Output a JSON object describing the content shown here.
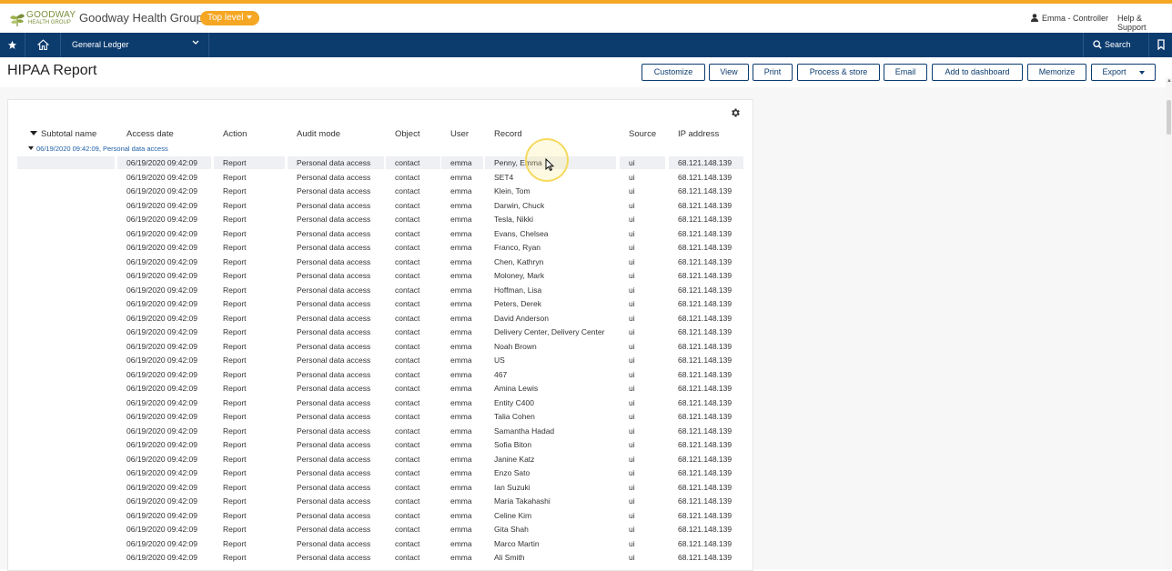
{
  "brand": {
    "logo_line1": "GOODWAY",
    "logo_line2": "HEALTH GROUP",
    "company": "Goodway Health Group",
    "level_badge": "Top level",
    "accent_color": "#f5a623",
    "nav_color": "#0c3b6e"
  },
  "header": {
    "user": "Emma - Controller",
    "help": "Help & Support"
  },
  "nav": {
    "app": "General Ledger",
    "search": "Search"
  },
  "page": {
    "title": "HIPAA Report",
    "buttons": {
      "customize": "Customize",
      "view": "View",
      "print": "Print",
      "process": "Process & store",
      "email": "Email",
      "dashboard": "Add to dashboard",
      "memorize": "Memorize",
      "export": "Export"
    }
  },
  "table": {
    "columns": {
      "subtotal": "Subtotal name",
      "access_date": "Access date",
      "action": "Action",
      "audit_mode": "Audit mode",
      "object": "Object",
      "user": "User",
      "record": "Record",
      "source": "Source",
      "ip": "IP address"
    },
    "group_label": "06/19/2020 09:42:09, Personal data access",
    "rows": [
      {
        "date": "06/19/2020 09:42:09",
        "action": "Report",
        "mode": "Personal data access",
        "object": "contact",
        "user": "emma",
        "record": "Penny, Emma",
        "source": "ui",
        "ip": "68.121.148.139"
      },
      {
        "date": "06/19/2020 09:42:09",
        "action": "Report",
        "mode": "Personal data access",
        "object": "contact",
        "user": "emma",
        "record": "SET4",
        "source": "ui",
        "ip": "68.121.148.139"
      },
      {
        "date": "06/19/2020 09:42:09",
        "action": "Report",
        "mode": "Personal data access",
        "object": "contact",
        "user": "emma",
        "record": "Klein, Tom",
        "source": "ui",
        "ip": "68.121.148.139"
      },
      {
        "date": "06/19/2020 09:42:09",
        "action": "Report",
        "mode": "Personal data access",
        "object": "contact",
        "user": "emma",
        "record": "Darwin, Chuck",
        "source": "ui",
        "ip": "68.121.148.139"
      },
      {
        "date": "06/19/2020 09:42:09",
        "action": "Report",
        "mode": "Personal data access",
        "object": "contact",
        "user": "emma",
        "record": "Tesla, Nikki",
        "source": "ui",
        "ip": "68.121.148.139"
      },
      {
        "date": "06/19/2020 09:42:09",
        "action": "Report",
        "mode": "Personal data access",
        "object": "contact",
        "user": "emma",
        "record": "Evans, Chelsea",
        "source": "ui",
        "ip": "68.121.148.139"
      },
      {
        "date": "06/19/2020 09:42:09",
        "action": "Report",
        "mode": "Personal data access",
        "object": "contact",
        "user": "emma",
        "record": "Franco, Ryan",
        "source": "ui",
        "ip": "68.121.148.139"
      },
      {
        "date": "06/19/2020 09:42:09",
        "action": "Report",
        "mode": "Personal data access",
        "object": "contact",
        "user": "emma",
        "record": "Chen, Kathryn",
        "source": "ui",
        "ip": "68.121.148.139"
      },
      {
        "date": "06/19/2020 09:42:09",
        "action": "Report",
        "mode": "Personal data access",
        "object": "contact",
        "user": "emma",
        "record": "Moloney, Mark",
        "source": "ui",
        "ip": "68.121.148.139"
      },
      {
        "date": "06/19/2020 09:42:09",
        "action": "Report",
        "mode": "Personal data access",
        "object": "contact",
        "user": "emma",
        "record": "Hoffman, Lisa",
        "source": "ui",
        "ip": "68.121.148.139"
      },
      {
        "date": "06/19/2020 09:42:09",
        "action": "Report",
        "mode": "Personal data access",
        "object": "contact",
        "user": "emma",
        "record": "Peters, Derek",
        "source": "ui",
        "ip": "68.121.148.139"
      },
      {
        "date": "06/19/2020 09:42:09",
        "action": "Report",
        "mode": "Personal data access",
        "object": "contact",
        "user": "emma",
        "record": "David Anderson",
        "source": "ui",
        "ip": "68.121.148.139"
      },
      {
        "date": "06/19/2020 09:42:09",
        "action": "Report",
        "mode": "Personal data access",
        "object": "contact",
        "user": "emma",
        "record": "Delivery Center, Delivery Center",
        "source": "ui",
        "ip": "68.121.148.139"
      },
      {
        "date": "06/19/2020 09:42:09",
        "action": "Report",
        "mode": "Personal data access",
        "object": "contact",
        "user": "emma",
        "record": "Noah Brown",
        "source": "ui",
        "ip": "68.121.148.139"
      },
      {
        "date": "06/19/2020 09:42:09",
        "action": "Report",
        "mode": "Personal data access",
        "object": "contact",
        "user": "emma",
        "record": "US",
        "source": "ui",
        "ip": "68.121.148.139"
      },
      {
        "date": "06/19/2020 09:42:09",
        "action": "Report",
        "mode": "Personal data access",
        "object": "contact",
        "user": "emma",
        "record": "467",
        "source": "ui",
        "ip": "68.121.148.139"
      },
      {
        "date": "06/19/2020 09:42:09",
        "action": "Report",
        "mode": "Personal data access",
        "object": "contact",
        "user": "emma",
        "record": "Amina Lewis",
        "source": "ui",
        "ip": "68.121.148.139"
      },
      {
        "date": "06/19/2020 09:42:09",
        "action": "Report",
        "mode": "Personal data access",
        "object": "contact",
        "user": "emma",
        "record": "Entity C400",
        "source": "ui",
        "ip": "68.121.148.139"
      },
      {
        "date": "06/19/2020 09:42:09",
        "action": "Report",
        "mode": "Personal data access",
        "object": "contact",
        "user": "emma",
        "record": "Talia Cohen",
        "source": "ui",
        "ip": "68.121.148.139"
      },
      {
        "date": "06/19/2020 09:42:09",
        "action": "Report",
        "mode": "Personal data access",
        "object": "contact",
        "user": "emma",
        "record": "Samantha Hadad",
        "source": "ui",
        "ip": "68.121.148.139"
      },
      {
        "date": "06/19/2020 09:42:09",
        "action": "Report",
        "mode": "Personal data access",
        "object": "contact",
        "user": "emma",
        "record": "Sofia Biton",
        "source": "ui",
        "ip": "68.121.148.139"
      },
      {
        "date": "06/19/2020 09:42:09",
        "action": "Report",
        "mode": "Personal data access",
        "object": "contact",
        "user": "emma",
        "record": "Janine Katz",
        "source": "ui",
        "ip": "68.121.148.139"
      },
      {
        "date": "06/19/2020 09:42:09",
        "action": "Report",
        "mode": "Personal data access",
        "object": "contact",
        "user": "emma",
        "record": "Enzo Sato",
        "source": "ui",
        "ip": "68.121.148.139"
      },
      {
        "date": "06/19/2020 09:42:09",
        "action": "Report",
        "mode": "Personal data access",
        "object": "contact",
        "user": "emma",
        "record": "Ian Suzuki",
        "source": "ui",
        "ip": "68.121.148.139"
      },
      {
        "date": "06/19/2020 09:42:09",
        "action": "Report",
        "mode": "Personal data access",
        "object": "contact",
        "user": "emma",
        "record": "Maria Takahashi",
        "source": "ui",
        "ip": "68.121.148.139"
      },
      {
        "date": "06/19/2020 09:42:09",
        "action": "Report",
        "mode": "Personal data access",
        "object": "contact",
        "user": "emma",
        "record": "Celine Kim",
        "source": "ui",
        "ip": "68.121.148.139"
      },
      {
        "date": "06/19/2020 09:42:09",
        "action": "Report",
        "mode": "Personal data access",
        "object": "contact",
        "user": "emma",
        "record": "Gita Shah",
        "source": "ui",
        "ip": "68.121.148.139"
      },
      {
        "date": "06/19/2020 09:42:09",
        "action": "Report",
        "mode": "Personal data access",
        "object": "contact",
        "user": "emma",
        "record": "Marco Martin",
        "source": "ui",
        "ip": "68.121.148.139"
      },
      {
        "date": "06/19/2020 09:42:09",
        "action": "Report",
        "mode": "Personal data access",
        "object": "contact",
        "user": "emma",
        "record": "Ali Smith",
        "source": "ui",
        "ip": "68.121.148.139"
      }
    ]
  }
}
